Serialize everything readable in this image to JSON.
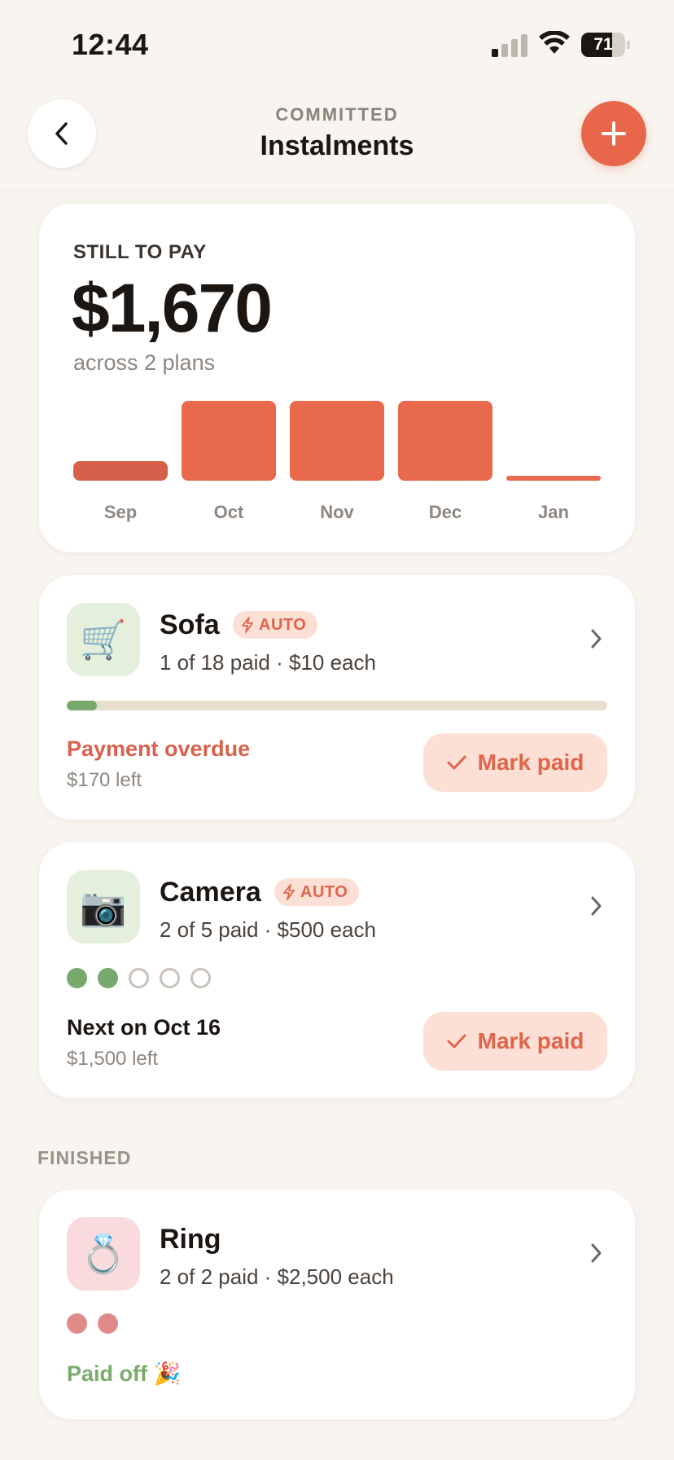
{
  "status_bar": {
    "time": "12:44",
    "battery": "71",
    "battery_level": 0.71,
    "signal_bars_active": 1
  },
  "header": {
    "overline": "COMMITTED",
    "title": "Instalments"
  },
  "summary": {
    "label": "STILL TO PAY",
    "amount": "$1,670",
    "subtitle": "across 2 plans"
  },
  "chart_data": {
    "type": "bar",
    "categories": [
      "Sep",
      "Oct",
      "Nov",
      "Dec",
      "Jan"
    ],
    "values": [
      170,
      690,
      690,
      690,
      10
    ],
    "colors": [
      "#d6604a",
      "#e8694b",
      "#e8694b",
      "#e8694b",
      "#e8694b"
    ],
    "title": "",
    "xlabel": "",
    "ylabel": ""
  },
  "plans": [
    {
      "name": "Sofa",
      "icon": "shopping-cart-icon",
      "emoji": "🛒",
      "icon_bg": "#e4f0dc",
      "auto": "AUTO",
      "subtitle": "1 of 18 paid · $10 each",
      "progress": 0.056,
      "status": "Payment overdue",
      "status_color": "#d9604a",
      "remaining": "$170 left",
      "action": "Mark paid"
    },
    {
      "name": "Camera",
      "icon": "camera-icon",
      "emoji": "📷",
      "icon_bg": "#e4f0dc",
      "auto": "AUTO",
      "subtitle": "2 of 5 paid · $500 each",
      "paid": 2,
      "total": 5,
      "status": "Next on Oct 16",
      "status_color": "#1c1613",
      "remaining": "$1,500 left",
      "action": "Mark paid"
    }
  ],
  "finished": {
    "label": "FINISHED",
    "plans": [
      {
        "name": "Ring",
        "icon": "ring-icon",
        "emoji": "💍",
        "icon_bg": "#fadbdd",
        "subtitle": "2 of 2 paid · $2,500 each",
        "paid": 2,
        "total": 2,
        "status": "Paid off",
        "status_emoji": "🎉",
        "status_color": "#7aab6c"
      }
    ]
  },
  "colors": {
    "accent": "#e8664a",
    "background": "#f8f4ef",
    "success": "#76a96b"
  }
}
